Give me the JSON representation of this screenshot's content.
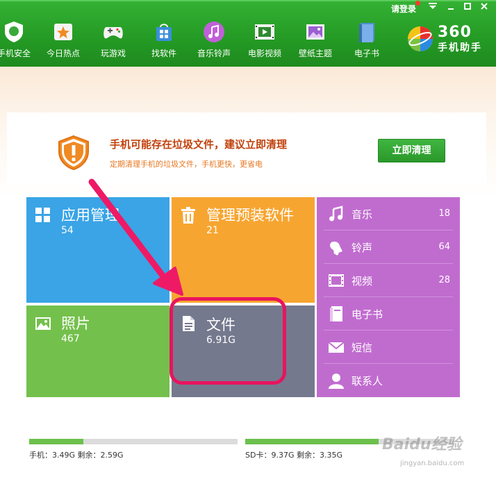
{
  "window": {
    "login_label": "请登录",
    "controls": [
      "menu",
      "minimize",
      "maximize",
      "close"
    ]
  },
  "nav": {
    "items": [
      {
        "label": "手机安全",
        "icon": "shield-icon"
      },
      {
        "label": "今日热点",
        "icon": "star-icon"
      },
      {
        "label": "玩游戏",
        "icon": "gamepad-icon"
      },
      {
        "label": "找软件",
        "icon": "shopping-bag-icon"
      },
      {
        "label": "音乐铃声",
        "icon": "music-note-icon"
      },
      {
        "label": "电影视频",
        "icon": "film-icon"
      },
      {
        "label": "壁纸主题",
        "icon": "picture-icon"
      },
      {
        "label": "电子书",
        "icon": "book-icon"
      }
    ]
  },
  "brand": {
    "number": "360",
    "name": "手机助手"
  },
  "alert": {
    "title": "手机可能存在垃圾文件，建议立即清理",
    "subtitle": "定期清理手机的垃圾文件，手机更快，更省电",
    "button_label": "立即清理"
  },
  "tiles": {
    "apps": {
      "title": "应用管理",
      "count": "54"
    },
    "preinstalled": {
      "title": "管理预装软件",
      "count": "21"
    },
    "photos": {
      "title": "照片",
      "count": "467"
    },
    "files": {
      "title": "文件",
      "count": "6.91G"
    }
  },
  "media": [
    {
      "label": "音乐",
      "count": "18",
      "icon": "music-note-icon"
    },
    {
      "label": "铃声",
      "count": "64",
      "icon": "bell-icon"
    },
    {
      "label": "视频",
      "count": "28",
      "icon": "film-icon"
    },
    {
      "label": "电子书",
      "count": "",
      "icon": "book-icon"
    },
    {
      "label": "短信",
      "count": "",
      "icon": "envelope-icon"
    },
    {
      "label": "联系人",
      "count": "",
      "icon": "person-icon"
    }
  ],
  "storage": {
    "phone": {
      "label": "手机：3.49G    剩余：2.59G",
      "used_fraction": 0.26
    },
    "sd": {
      "label": "SD卡：9.37G    剩余：3.35G",
      "used_fraction": 0.64
    }
  },
  "watermark": {
    "main": "Baidu经验",
    "url": "jingyan.baidu.com"
  },
  "colors": {
    "topbar": "#249a24",
    "apps_tile": "#3aa4e6",
    "preinstalled_tile": "#f7a531",
    "photos_tile": "#74c04c",
    "files_tile": "#75798e",
    "media_tile": "#c06ccf",
    "highlight": "#e8145e",
    "alert_title": "#c1420c"
  }
}
